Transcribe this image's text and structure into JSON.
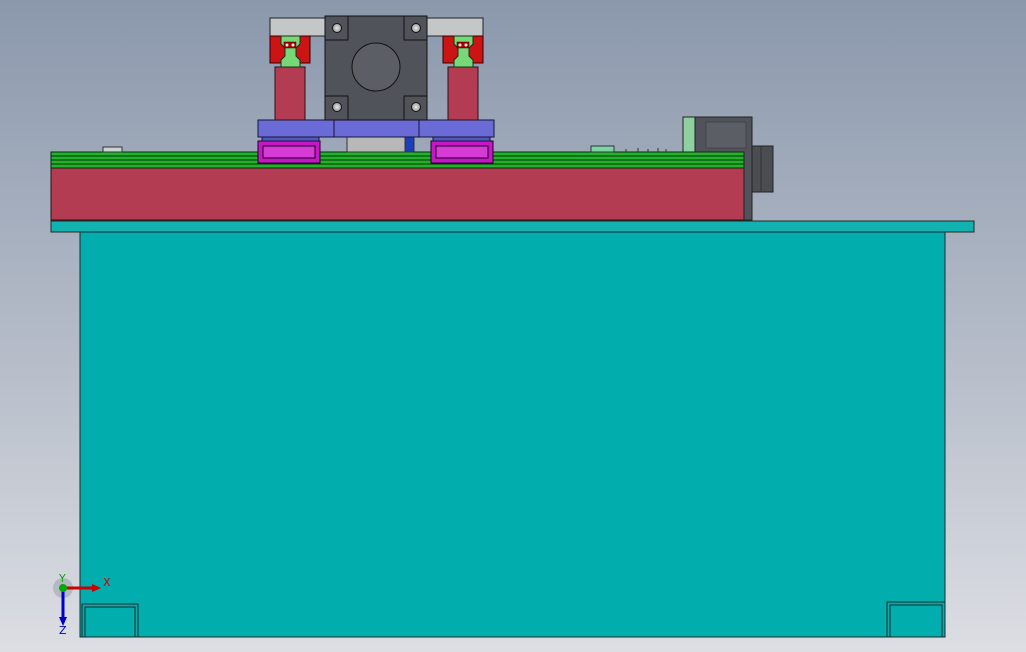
{
  "triad": {
    "x_label": "X",
    "y_label": "Y",
    "z_label": "Z"
  },
  "colors": {
    "background_top": "#8b98ac",
    "background_bottom": "#dcdee3",
    "base_cabinet": "#02adad",
    "base_plate": "#12b2b0",
    "rail_body": "#b43c52",
    "rail_green": "#1fb52a",
    "carriage_magenta": "#c815c8",
    "slide_plate": "#6b6bd8",
    "motor_dark": "#505359",
    "red_block": "#cc1414",
    "light_green": "#78d878",
    "axis_x": "#cc0000",
    "axis_y": "#00aa00",
    "axis_z": "#0000cc"
  }
}
